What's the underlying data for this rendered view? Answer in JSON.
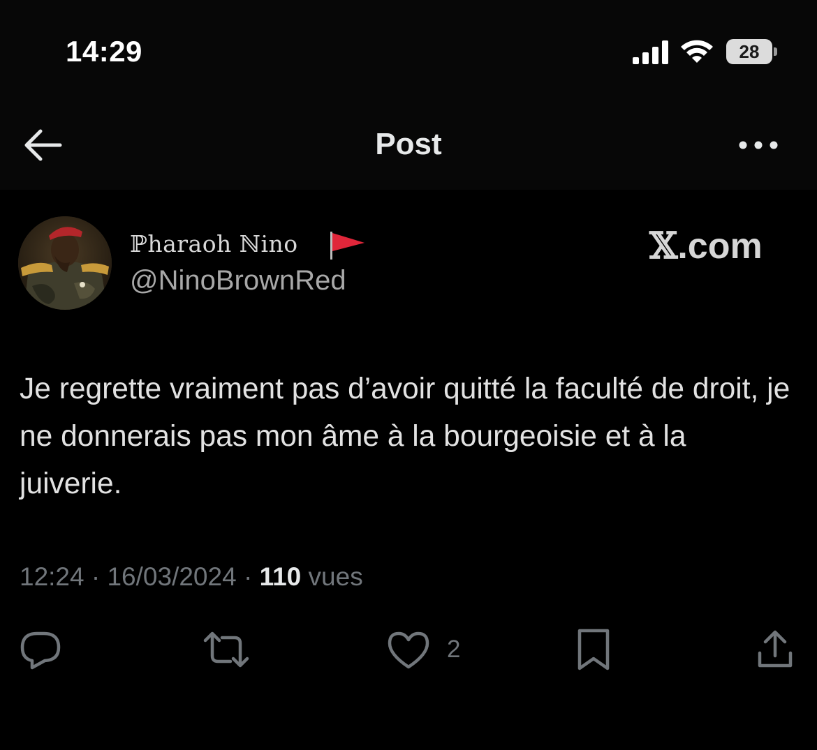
{
  "status_bar": {
    "time": "14:29",
    "battery": "28",
    "icons": [
      "signal-icon",
      "wifi-icon",
      "battery-icon"
    ]
  },
  "header": {
    "title": "Post",
    "back_icon": "back-arrow-icon",
    "more_icon": "more-dots-icon"
  },
  "post": {
    "author_name": "ℙharaoh ℕino",
    "author_flag_icon": "red-flag-icon",
    "handle": "@NinoBrownRed",
    "brand": {
      "x": "𝕏",
      "suffix": ".com"
    },
    "text": "Je regrette vraiment pas d’avoir quitté la faculté de droit, je ne donnerais pas mon âme à la bourgeoisie et à la juiverie.",
    "time": "12:24",
    "separator": "·",
    "date": "16/03/2024",
    "views_count": "110",
    "views_label": "vues"
  },
  "actions": {
    "reply_icon": "reply-icon",
    "repost_icon": "repost-icon",
    "like_icon": "heart-icon",
    "like_count": "2",
    "bookmark_icon": "bookmark-icon",
    "share_icon": "share-icon"
  },
  "colors": {
    "background": "#000000",
    "header_background": "#070707",
    "text_primary": "#e7e9ea",
    "text_secondary": "#71767b",
    "flag_red": "#e0263a"
  }
}
